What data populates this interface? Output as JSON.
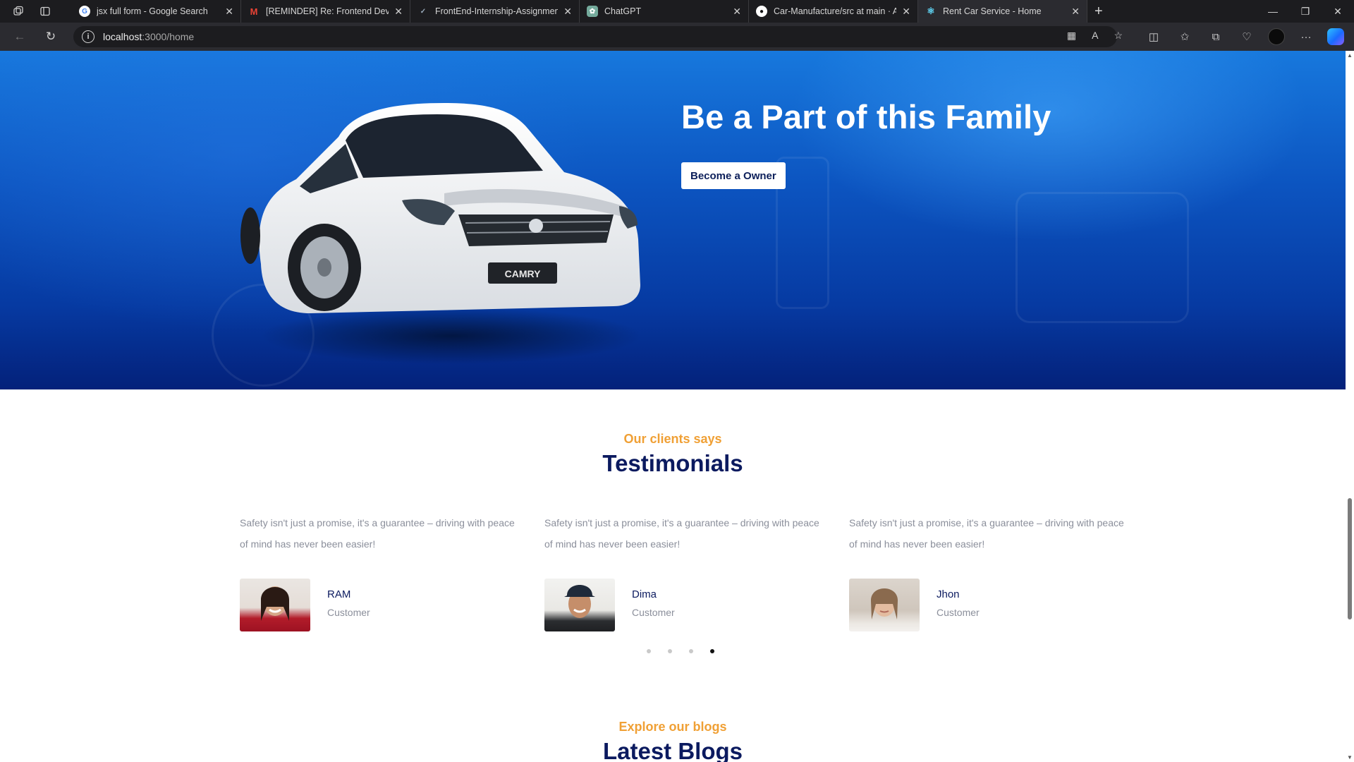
{
  "browser": {
    "tabs": [
      {
        "title": "jsx full form - Google Search",
        "icon": "google-icon",
        "active": false
      },
      {
        "title": "[REMINDER] Re: Frontend Develo",
        "icon": "gmail-icon",
        "active": false
      },
      {
        "title": "FrontEnd-Internship-Assignment",
        "icon": "internshala-icon",
        "active": false
      },
      {
        "title": "ChatGPT",
        "icon": "chatgpt-icon",
        "active": false
      },
      {
        "title": "Car-Manufacture/src at main · Ar",
        "icon": "github-icon",
        "active": false
      },
      {
        "title": "Rent Car Service - Home",
        "icon": "react-icon",
        "active": true
      }
    ],
    "url_host": "localhost",
    "url_path": ":3000/home"
  },
  "hero": {
    "title": "Be a Part of this Family",
    "button_label": "Become a Owner",
    "car_plate": "CAMRY"
  },
  "testimonials": {
    "subtitle": "Our clients says",
    "title": "Testimonials",
    "items": [
      {
        "quote": "Safety isn't just a promise, it's a guarantee – driving with peace of mind has never been easier!",
        "name": "RAM",
        "role": "Customer"
      },
      {
        "quote": "Safety isn't just a promise, it's a guarantee – driving with peace of mind has never been easier!",
        "name": "Dima",
        "role": "Customer"
      },
      {
        "quote": "Safety isn't just a promise, it's a guarantee – driving with peace of mind has never been easier!",
        "name": "Jhon",
        "role": "Customer"
      }
    ],
    "active_dot": 4,
    "dot_count": 4
  },
  "blogs": {
    "subtitle": "Explore our blogs",
    "title": "Latest Blogs"
  },
  "colors": {
    "accent": "#f0a035",
    "heading": "#0b1a5f",
    "hero_blue": "#0c54c0"
  }
}
